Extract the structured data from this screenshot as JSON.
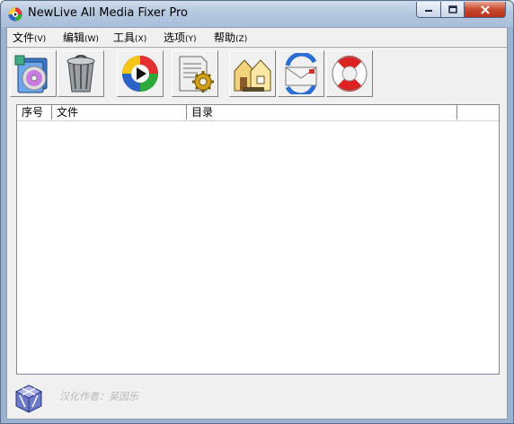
{
  "window": {
    "title": "NewLive All Media Fixer Pro",
    "accent": "#b5c8df",
    "close_color": "#c9482d"
  },
  "menu": [
    {
      "label": "文件",
      "accel": "(V)"
    },
    {
      "label": "编辑",
      "accel": "(W)"
    },
    {
      "label": "工具",
      "accel": "(X)"
    },
    {
      "label": "选项",
      "accel": "(Y)"
    },
    {
      "label": "帮助",
      "accel": "(Z)"
    }
  ],
  "toolbar": [
    {
      "icon": "add-media-icon"
    },
    {
      "icon": "trash-bin-icon"
    },
    {
      "icon": "media-play-icon"
    },
    {
      "icon": "settings-document-icon"
    },
    {
      "icon": "home-folders-icon"
    },
    {
      "icon": "email-icon"
    },
    {
      "icon": "lifebuoy-help-icon"
    }
  ],
  "list": {
    "columns": [
      "序号",
      "文件",
      "目录",
      ""
    ],
    "rows": []
  },
  "status": {
    "credit": "汉化作者：吴国乐"
  }
}
